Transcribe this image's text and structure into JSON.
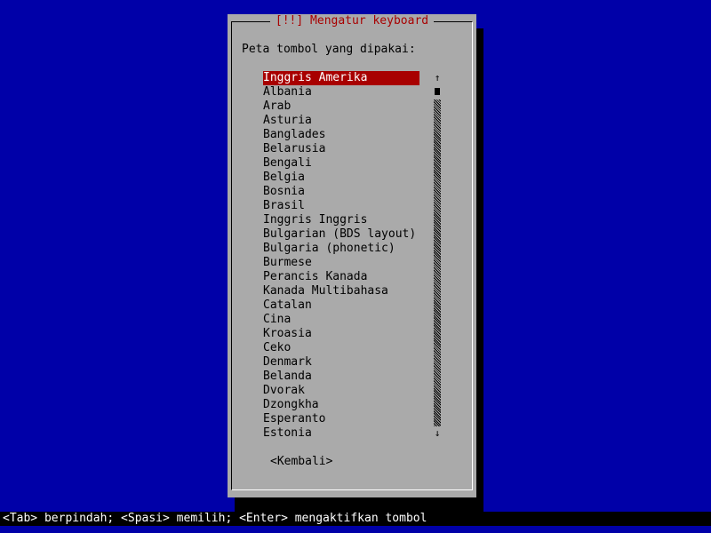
{
  "dialog": {
    "title": "[!!] Mengatur keyboard",
    "prompt": "Peta tombol yang dipakai:",
    "items": [
      "Inggris Amerika",
      "Albania",
      "Arab",
      "Asturia",
      "Banglades",
      "Belarusia",
      "Bengali",
      "Belgia",
      "Bosnia",
      "Brasil",
      "Inggris Inggris",
      "Bulgarian (BDS layout)",
      "Bulgaria (phonetic)",
      "Burmese",
      "Perancis Kanada",
      "Kanada Multibahasa",
      "Catalan",
      "Cina",
      "Kroasia",
      "Ceko",
      "Denmark",
      "Belanda",
      "Dvorak",
      "Dzongkha",
      "Esperanto",
      "Estonia"
    ],
    "selected_index": 0,
    "back_label": "<Kembali>",
    "scroll_up": "↑",
    "scroll_down": "↓"
  },
  "status_bar": "<Tab> berpindah; <Spasi> memilih; <Enter> mengaktifkan tombol",
  "colors": {
    "background": "#0000a8",
    "dialog": "#aaaaaa",
    "highlight": "#a80000",
    "title": "#a80000"
  }
}
